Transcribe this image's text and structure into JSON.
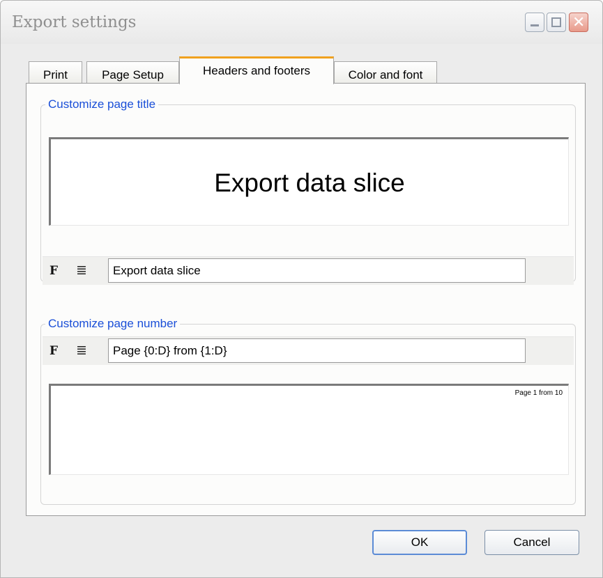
{
  "window": {
    "title": "Export settings",
    "close_glyph": "✕"
  },
  "tabs": [
    {
      "label": "Print"
    },
    {
      "label": "Page Setup"
    },
    {
      "label": "Headers and footers"
    },
    {
      "label": "Color and font"
    }
  ],
  "active_tab": "Headers and footers",
  "page_title": {
    "legend": "Customize page title",
    "preview_text": "Export data slice",
    "font_button": "F",
    "align_button": "≣",
    "input_value": "Export data slice"
  },
  "page_number": {
    "legend": "Customize page number",
    "font_button": "F",
    "align_button": "≣",
    "input_value": "Page {0:D} from {1:D}",
    "preview_text": "Page 1 from 10"
  },
  "buttons": {
    "ok": "OK",
    "cancel": "Cancel"
  },
  "colors": {
    "legend_text": "#1a4fd8",
    "active_tab_accent": "#f0a11e"
  }
}
